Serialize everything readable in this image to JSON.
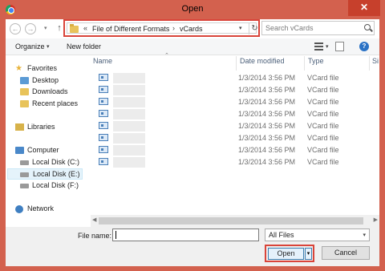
{
  "window": {
    "title": "Open",
    "close_glyph": "✕",
    "app_icon": "chrome-icon"
  },
  "nav": {
    "back_glyph": "←",
    "forward_glyph": "→",
    "recent_glyph": "▾",
    "up_glyph": "↑",
    "breadcrumb": {
      "overflow": "«",
      "items": [
        "File of Different Formats",
        "vCards"
      ],
      "separator": "›"
    },
    "dropdown_glyph": "▾",
    "refresh_glyph": "↻"
  },
  "search": {
    "placeholder": "Search vCards"
  },
  "toolbar": {
    "organize": "Organize",
    "organize_caret": "▾",
    "new_folder": "New folder",
    "view_caret": "▾",
    "help": "?"
  },
  "navpane": {
    "favorites": "Favorites",
    "desktop": "Desktop",
    "downloads": "Downloads",
    "recent_places": "Recent places",
    "libraries": "Libraries",
    "computer": "Computer",
    "disk_c": "Local Disk (C:)",
    "disk_e": "Local Disk (E:)",
    "disk_f": "Local Disk (F:)",
    "network": "Network"
  },
  "columns": {
    "name": "Name",
    "date": "Date modified",
    "type": "Type",
    "size": "Si"
  },
  "files": [
    {
      "date": "1/3/2014 3:56 PM",
      "type": "VCard file"
    },
    {
      "date": "1/3/2014 3:56 PM",
      "type": "VCard file"
    },
    {
      "date": "1/3/2014 3:56 PM",
      "type": "VCard file"
    },
    {
      "date": "1/3/2014 3:56 PM",
      "type": "VCard file"
    },
    {
      "date": "1/3/2014 3:56 PM",
      "type": "VCard file"
    },
    {
      "date": "1/3/2014 3:56 PM",
      "type": "VCard file"
    },
    {
      "date": "1/3/2014 3:56 PM",
      "type": "VCard file"
    },
    {
      "date": "1/3/2014 3:56 PM",
      "type": "VCard file"
    }
  ],
  "bottom": {
    "file_name_label": "File name:",
    "file_name_value": "",
    "filter": "All Files",
    "filter_caret": "▾",
    "open": "Open",
    "open_split_glyph": "▾",
    "cancel": "Cancel"
  },
  "colors": {
    "title_bar": "#d3614e",
    "highlight": "#d9443a",
    "selected": "#e5f3fb"
  }
}
